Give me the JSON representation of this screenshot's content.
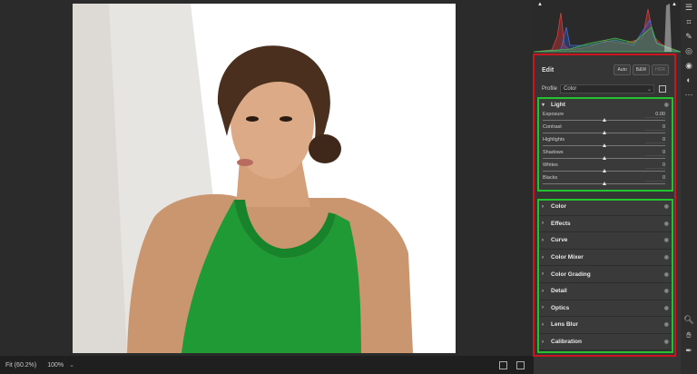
{
  "edit": {
    "title": "Edit",
    "auto_label": "Auto",
    "bw_label": "B&W",
    "hdr_label": "HDR"
  },
  "profile": {
    "label": "Profile",
    "value": "Color"
  },
  "light": {
    "title": "Light",
    "sliders": [
      {
        "name": "Exposure",
        "value": "0.00"
      },
      {
        "name": "Contrast",
        "value": "0"
      },
      {
        "name": "Highlights",
        "value": "0"
      },
      {
        "name": "Shadows",
        "value": "0"
      },
      {
        "name": "Whites",
        "value": "0"
      },
      {
        "name": "Blacks",
        "value": "0"
      }
    ]
  },
  "sections": [
    "Color",
    "Effects",
    "Curve",
    "Color Mixer",
    "Color Grading",
    "Detail",
    "Optics",
    "Lens Blur",
    "Calibration"
  ],
  "bottom_bar": {
    "fit_label": "Fit (60.2%)",
    "zoom_label": "100%"
  },
  "tools": [
    "sliders-icon",
    "crop-icon",
    "heal-icon",
    "mask-icon",
    "redeye-icon",
    "presets-icon",
    "more-icon"
  ],
  "colors": {
    "annotation_red": "#c9161f",
    "annotation_green": "#22c32c",
    "shirt_green": "#1f9a35"
  }
}
